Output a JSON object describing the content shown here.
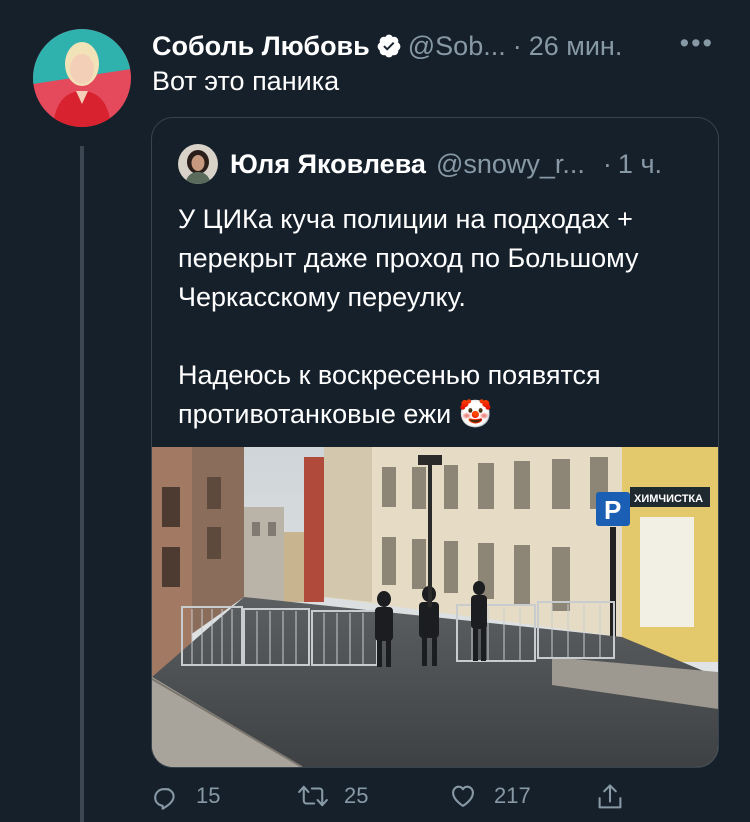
{
  "tweet": {
    "author_name": "Соболь Любовь",
    "handle": "@Sob...",
    "separator": "·",
    "time": "26 мин.",
    "more": "•••",
    "text": "Вот это паника"
  },
  "quoted": {
    "author_name": "Юля Яковлева",
    "handle": "@snowy_r...",
    "separator": "·",
    "time": "1 ч.",
    "paragraph1": "У ЦИКа куча полиции на подходах + перекрыт даже проход по Большому Черкасскому переулку.",
    "paragraph2": "Надеюсь к воскресенью появятся противотанковые ежи 🤡",
    "image_signs": {
      "parking": "P",
      "shop": "ХИМЧИСТКА"
    }
  },
  "actions": {
    "reply_count": "15",
    "retweet_count": "25",
    "like_count": "217"
  },
  "colors": {
    "background": "#15202b",
    "muted": "#8899a6",
    "border": "#38444d",
    "verified": "#ffffff"
  },
  "icons": [
    "verified-badge-icon",
    "more-icon",
    "reply-icon",
    "retweet-icon",
    "like-icon",
    "share-icon"
  ]
}
